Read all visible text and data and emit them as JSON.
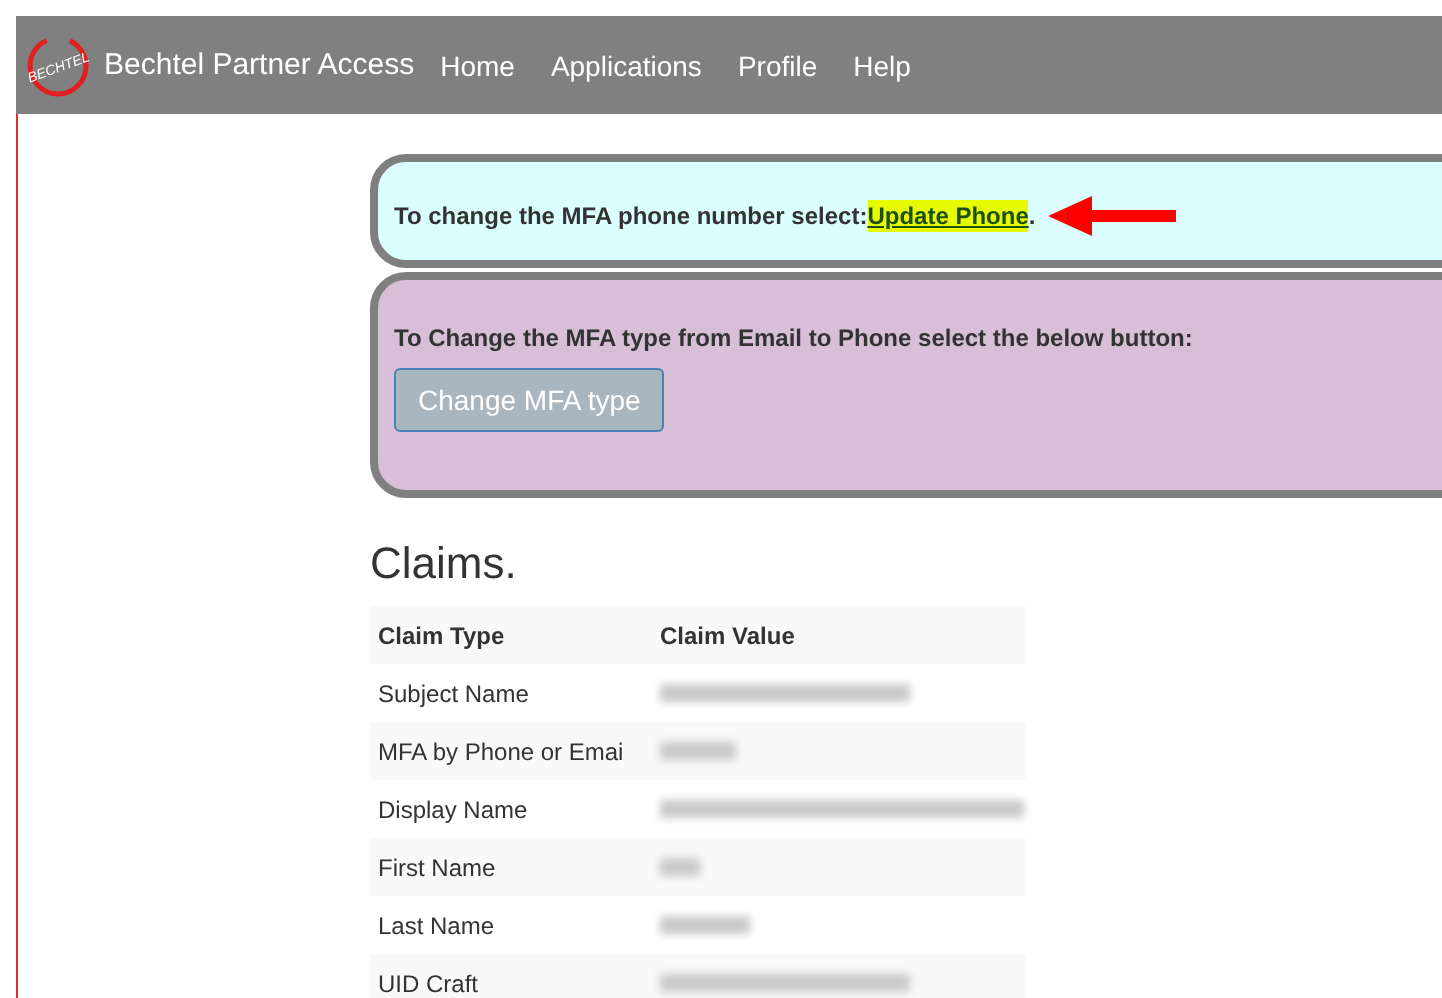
{
  "navbar": {
    "brand": "Bechtel Partner Access",
    "logo_text": "BECHTEL",
    "links": [
      "Home",
      "Applications",
      "Profile",
      "Help"
    ]
  },
  "phone_panel": {
    "text": "To change the MFA phone number select:",
    "link": " Update Phone",
    "suffix": "."
  },
  "type_panel": {
    "text": "To Change the MFA type from Email to Phone select the below button:",
    "button": "Change MFA type"
  },
  "claims": {
    "title": "Claims.",
    "columns": [
      "Claim Type",
      "Claim Value"
    ],
    "rows": [
      {
        "type": "Subject Name"
      },
      {
        "type": "MFA by Phone or Emai"
      },
      {
        "type": "Display Name"
      },
      {
        "type": "First Name"
      },
      {
        "type": "Last Name"
      },
      {
        "type": "UID Craft"
      }
    ]
  }
}
